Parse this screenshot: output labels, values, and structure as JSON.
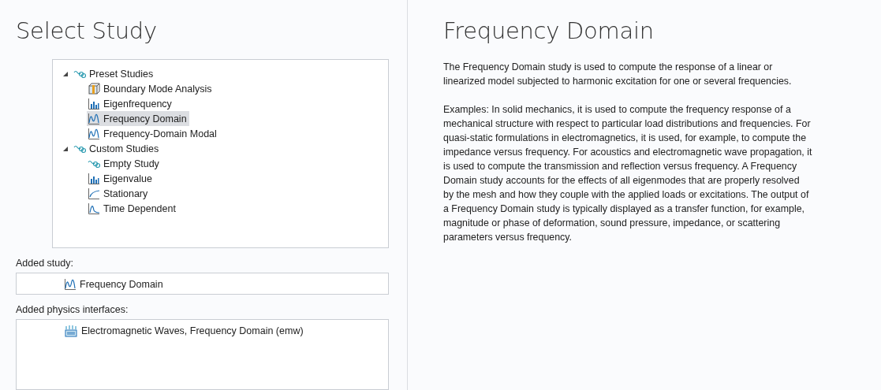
{
  "left": {
    "title": "Select Study",
    "tree": [
      {
        "label": "Preset Studies",
        "kind": "group",
        "expanded": true,
        "selected": false,
        "children": [
          {
            "label": "Boundary Mode Analysis",
            "kind": "mode",
            "selected": false
          },
          {
            "label": "Eigenfrequency",
            "kind": "eigen",
            "selected": false
          },
          {
            "label": "Frequency Domain",
            "kind": "wave",
            "selected": true
          },
          {
            "label": "Frequency-Domain Modal",
            "kind": "wave",
            "selected": false
          }
        ]
      },
      {
        "label": "Custom Studies",
        "kind": "group",
        "expanded": true,
        "selected": false,
        "children": [
          {
            "label": "Empty Study",
            "kind": "group",
            "selected": false
          },
          {
            "label": "Eigenvalue",
            "kind": "eigen",
            "selected": false
          },
          {
            "label": "Stationary",
            "kind": "stationary",
            "selected": false
          },
          {
            "label": "Time Dependent",
            "kind": "time",
            "selected": false
          }
        ]
      }
    ],
    "added_study": {
      "label": "Added study:",
      "items": [
        {
          "label": "Frequency Domain",
          "kind": "wave"
        }
      ]
    },
    "added_physics": {
      "label": "Added physics interfaces:",
      "items": [
        {
          "label": "Electromagnetic Waves, Frequency Domain (emw)",
          "kind": "physics"
        }
      ]
    }
  },
  "right": {
    "title": "Frequency Domain",
    "paragraphs": [
      "The Frequency Domain study is used to compute the response of a linear or linearized model subjected to harmonic excitation for one or several frequencies.",
      "Examples: In solid mechanics, it is used to compute the frequency response of a mechanical structure with respect to particular load distributions and frequencies. For quasi-static formulations in electromagnetics, it is used, for example, to compute the impedance versus frequency. For acoustics and electromagnetic wave propagation, it is used to compute the transmission and reflection versus frequency. A Frequency Domain study accounts for the effects of all eigenmodes that are properly resolved by the mesh and how they couple with the applied loads or excitations. The output of a Frequency Domain study is typically displayed as a transfer function, for example, magnitude or phase of deformation, sound pressure, impedance, or scattering parameters versus frequency."
    ]
  }
}
